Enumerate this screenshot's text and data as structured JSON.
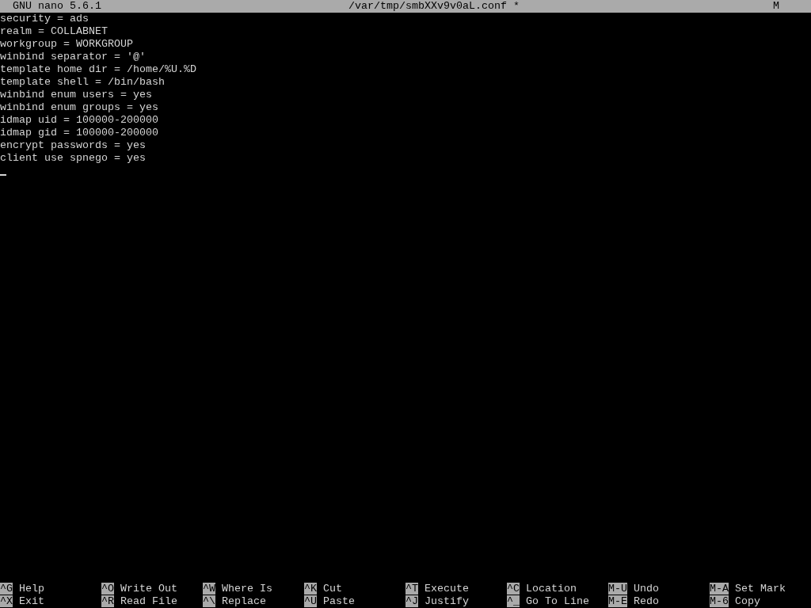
{
  "title_bar": {
    "app": "GNU nano 5.6.1",
    "file": "/var/tmp/smbXXv9v0aL.conf *",
    "flag": "M"
  },
  "lines": [
    "security = ads",
    "realm = COLLABNET",
    "workgroup = WORKGROUP",
    "winbind separator = '@'",
    "template home dir = /home/%U.%D",
    "template shell = /bin/bash",
    "winbind enum users = yes",
    "winbind enum groups = yes",
    "idmap uid = 100000-200000",
    "idmap gid = 100000-200000",
    "encrypt passwords = yes",
    "client use spnego = yes"
  ],
  "shortcuts": [
    {
      "key": "^G",
      "label": "Help"
    },
    {
      "key": "^O",
      "label": "Write Out"
    },
    {
      "key": "^W",
      "label": "Where Is"
    },
    {
      "key": "^K",
      "label": "Cut"
    },
    {
      "key": "^T",
      "label": "Execute"
    },
    {
      "key": "^C",
      "label": "Location"
    },
    {
      "key": "M-U",
      "label": "Undo"
    },
    {
      "key": "M-A",
      "label": "Set Mark"
    },
    {
      "key": "^X",
      "label": "Exit"
    },
    {
      "key": "^R",
      "label": "Read File"
    },
    {
      "key": "^\\",
      "label": "Replace"
    },
    {
      "key": "^U",
      "label": "Paste"
    },
    {
      "key": "^J",
      "label": "Justify"
    },
    {
      "key": "^_",
      "label": "Go To Line"
    },
    {
      "key": "M-E",
      "label": "Redo"
    },
    {
      "key": "M-6",
      "label": "Copy"
    }
  ]
}
